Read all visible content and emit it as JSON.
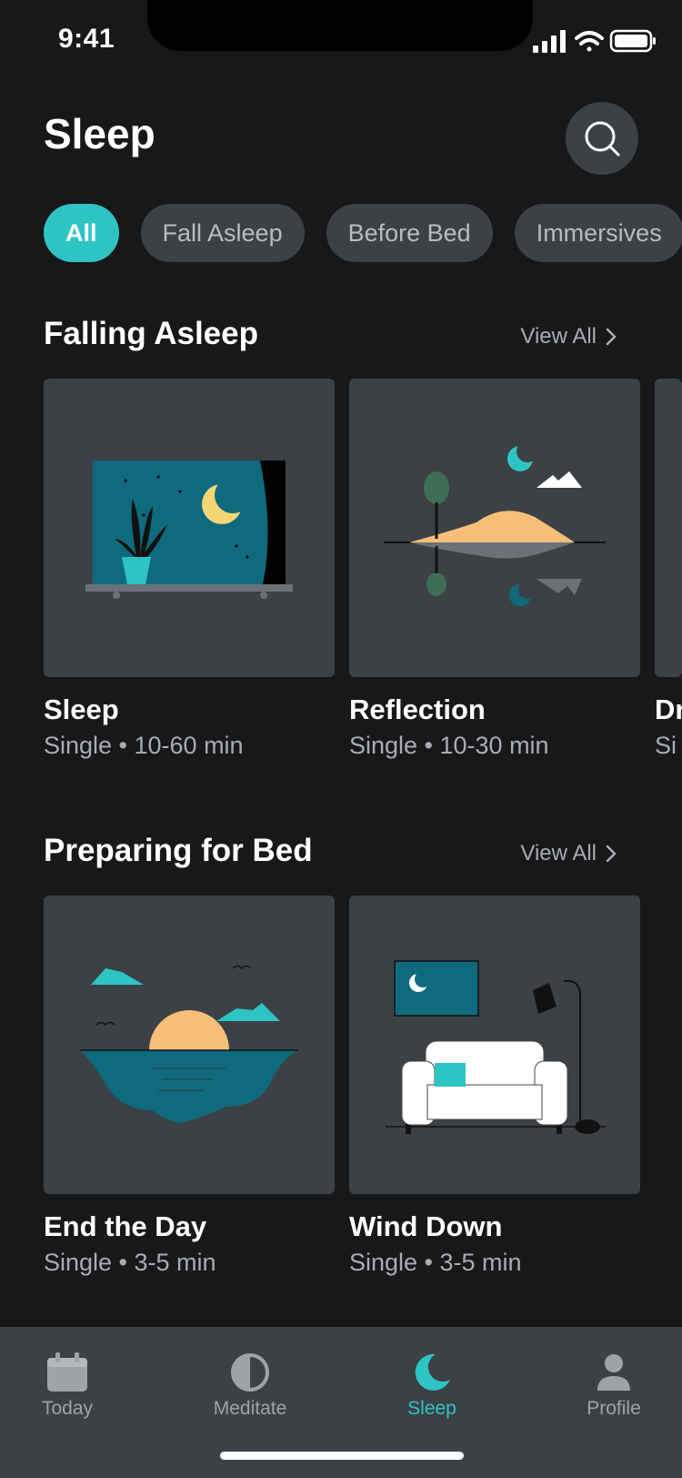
{
  "status": {
    "time": "9:41"
  },
  "header": {
    "title": "Sleep"
  },
  "chips": [
    "All",
    "Fall Asleep",
    "Before Bed",
    "Immersives"
  ],
  "sections": [
    {
      "title": "Falling Asleep",
      "view_all": "View All",
      "cards": [
        {
          "title": "Sleep",
          "meta": "Single • 10-60 min"
        },
        {
          "title": "Reflection",
          "meta": "Single • 10-30 min"
        },
        {
          "title": "Dr",
          "meta": "Si"
        }
      ]
    },
    {
      "title": "Preparing for Bed",
      "view_all": "View All",
      "cards": [
        {
          "title": "End the Day",
          "meta": "Single • 3-5 min"
        },
        {
          "title": "Wind Down",
          "meta": "Single • 3-5 min"
        }
      ]
    }
  ],
  "tabs": [
    {
      "label": "Today",
      "icon": "calendar-icon"
    },
    {
      "label": "Meditate",
      "icon": "half-circle-icon"
    },
    {
      "label": "Sleep",
      "icon": "moon-icon",
      "active": true
    },
    {
      "label": "Profile",
      "icon": "person-icon"
    }
  ],
  "colors": {
    "background": "#17181a",
    "surface": "#3c4146",
    "accent": "#2fc4c4"
  }
}
